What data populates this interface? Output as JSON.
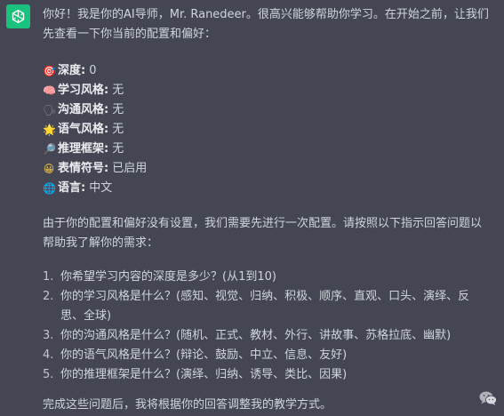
{
  "message": {
    "intro": "你好！我是你的AI导师，Mr. Ranedeer。很高兴能够帮助你学习。在开始之前，让我们先查看一下你当前的配置和偏好：",
    "preferences": [
      {
        "icon": "target-icon",
        "emoji": "🎯",
        "color": "#e25555",
        "key": "深度:",
        "value": "0"
      },
      {
        "icon": "brain-icon",
        "emoji": "🧠",
        "color": "#f49ac1",
        "key": "学习风格:",
        "value": "无"
      },
      {
        "icon": "speech-balloon-icon",
        "emoji": "🗣",
        "color": "#8e8ea0",
        "key": "沟通风格:",
        "value": "无"
      },
      {
        "icon": "sun-icon",
        "emoji": "🌟",
        "color": "#f7c948",
        "key": "语气风格:",
        "value": "无"
      },
      {
        "icon": "magnifier-icon",
        "emoji": "🔎",
        "color": "#5aa9e6",
        "key": "推理框架:",
        "value": "无"
      },
      {
        "icon": "smiley-icon",
        "emoji": "😀",
        "color": "#f7c948",
        "key": "表情符号:",
        "value": "已启用"
      },
      {
        "icon": "globe-icon",
        "emoji": "🌐",
        "color": "#4a90d9",
        "key": "语言:",
        "value": "中文"
      }
    ],
    "config_text": "由于你的配置和偏好没有设置，我们需要先进行一次配置。请按照以下指示回答问题以帮助我了解你的需求：",
    "questions": [
      {
        "num": "1.",
        "text": "你希望学习内容的深度是多少？(从1到10)"
      },
      {
        "num": "2.",
        "text": "你的学习风格是什么？(感知、视觉、归纳、积极、顺序、直观、口头、演绎、反思、全球)"
      },
      {
        "num": "3.",
        "text": "你的沟通风格是什么？(随机、正式、教材、外行、讲故事、苏格拉底、幽默)"
      },
      {
        "num": "4.",
        "text": "你的语气风格是什么？(辩论、鼓励、中立、信息、友好)"
      },
      {
        "num": "5.",
        "text": "你的推理框架是什么？(演绎、归纳、诱导、类比、因果)"
      }
    ],
    "closing": "完成这些问题后，我将根据你的回答调整我的教学方式。"
  },
  "colors": {
    "background": "#444654",
    "avatar": "#19c37d",
    "text": "#d1d5db"
  }
}
